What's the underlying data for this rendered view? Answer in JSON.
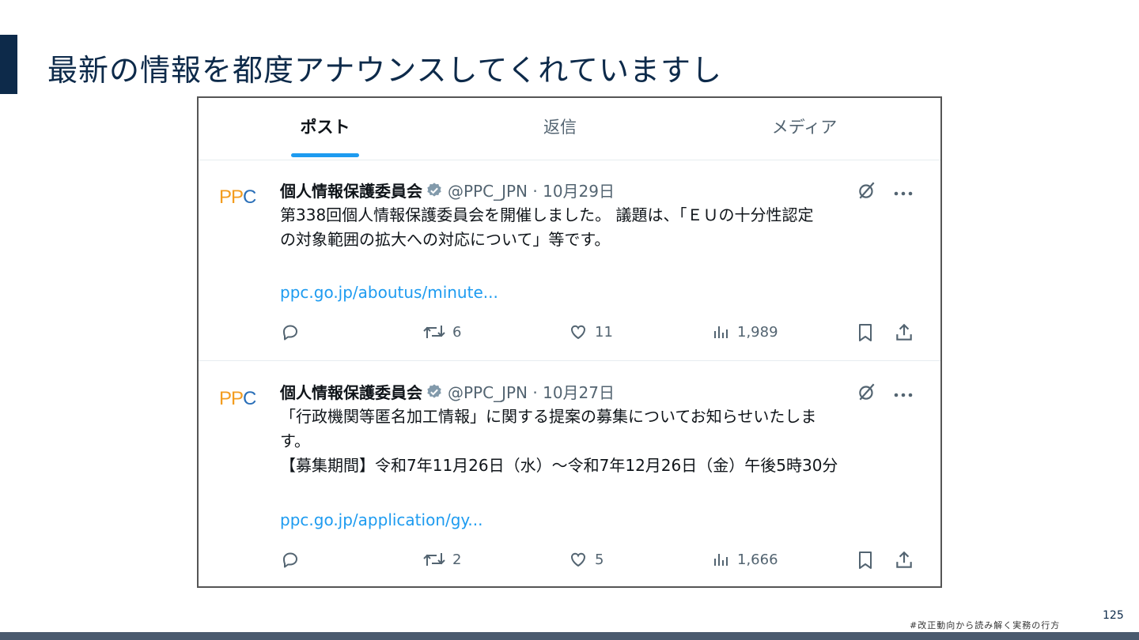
{
  "slide": {
    "title": "最新の情報を都度アナウンスしてくれていますし",
    "footer": "#改正動向から読み解く実務の行方",
    "page_number": "125"
  },
  "tabs": [
    {
      "label": "ポスト",
      "active": true
    },
    {
      "label": "返信",
      "active": false
    },
    {
      "label": "メディア",
      "active": false
    }
  ],
  "tweets": [
    {
      "avatar_text": "PPC",
      "name": "個人情報保護委員会",
      "handle": "@PPC_JPN",
      "date": "10月29日",
      "separator": "·",
      "body": [
        "第338回個人情報保護委員会を開催しました。 議題は、「ＥＵの十分性認定",
        "の対象範囲の拡大への対応について」等です。"
      ],
      "link": "ppc.go.jp/aboutus/minute...",
      "reposts": "6",
      "likes": "11",
      "views": "1,989"
    },
    {
      "avatar_text": "PPC",
      "name": "個人情報保護委員会",
      "handle": "@PPC_JPN",
      "date": "10月27日",
      "separator": "·",
      "body": [
        "「行政機関等匿名加工情報」に関する提案の募集についてお知らせいたしま",
        "す。",
        "【募集期間】令和7年11月26日（水）～令和7年12月26日（金）午後5時30分"
      ],
      "link": "ppc.go.jp/application/gy...",
      "reposts": "2",
      "likes": "5",
      "views": "1,666"
    }
  ],
  "colors": {
    "accent": "#1d9bf0",
    "title": "#0d2a4a",
    "muted": "#536471"
  },
  "icons": [
    "verified-badge-icon",
    "grok-icon",
    "more-icon",
    "reply-icon",
    "repost-icon",
    "like-icon",
    "views-icon",
    "bookmark-icon",
    "share-icon"
  ]
}
